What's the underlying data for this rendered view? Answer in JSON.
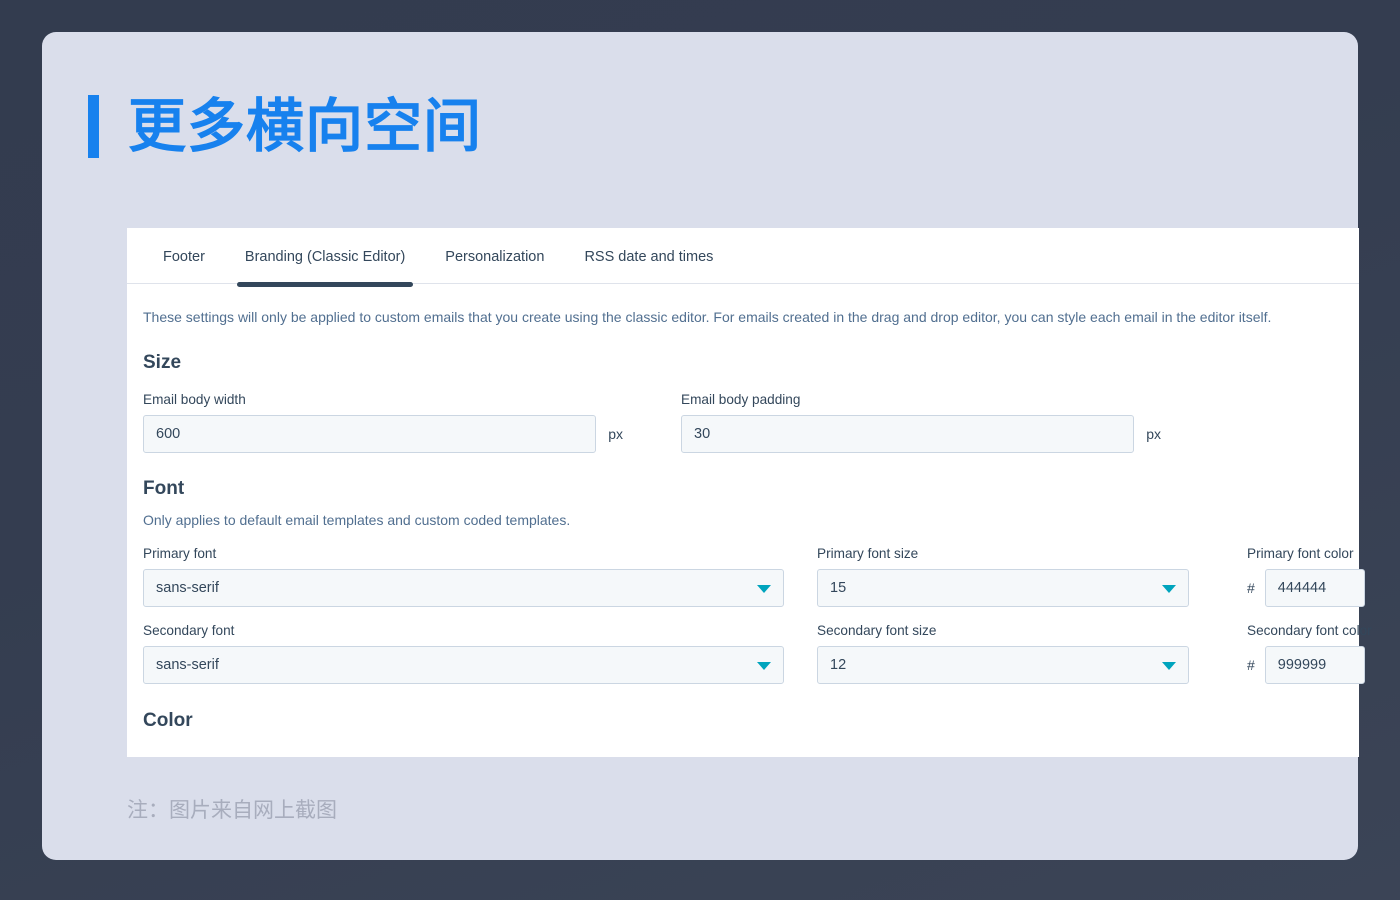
{
  "page": {
    "title": "更多横向空间",
    "note": "注：图片来自网上截图",
    "accent_blue": "#1781ee",
    "panel_bg": "#dadeeb",
    "outer_bg": "#333c4f",
    "caret_color": "#00a4bd",
    "active_tab_color": "#33475b"
  },
  "tabs": [
    {
      "label": "Footer",
      "active": false
    },
    {
      "label": "Branding (Classic Editor)",
      "active": true
    },
    {
      "label": "Personalization",
      "active": false
    },
    {
      "label": "RSS date and times",
      "active": false
    }
  ],
  "description": "These settings will only be applied to custom emails that you create using the classic editor. For emails created in the drag and drop editor, you can style each email in the editor itself.",
  "sections": {
    "size": {
      "heading": "Size",
      "fields": [
        {
          "label": "Email body width",
          "value": "600",
          "unit": "px"
        },
        {
          "label": "Email body padding",
          "value": "30",
          "unit": "px"
        }
      ]
    },
    "font": {
      "heading": "Font",
      "description": "Only applies to default email templates and custom coded templates.",
      "primary_font": {
        "label": "Primary font",
        "value": "sans-serif"
      },
      "primary_font_size": {
        "label": "Primary font size",
        "value": "15"
      },
      "primary_font_color": {
        "label": "Primary font color",
        "prefix": "#",
        "value": "444444"
      },
      "secondary_font": {
        "label": "Secondary font",
        "value": "sans-serif"
      },
      "secondary_font_size": {
        "label": "Secondary font size",
        "value": "12"
      },
      "secondary_font_color": {
        "label": "Secondary font color",
        "prefix": "#",
        "value": "999999"
      }
    },
    "color": {
      "heading": "Color"
    }
  }
}
